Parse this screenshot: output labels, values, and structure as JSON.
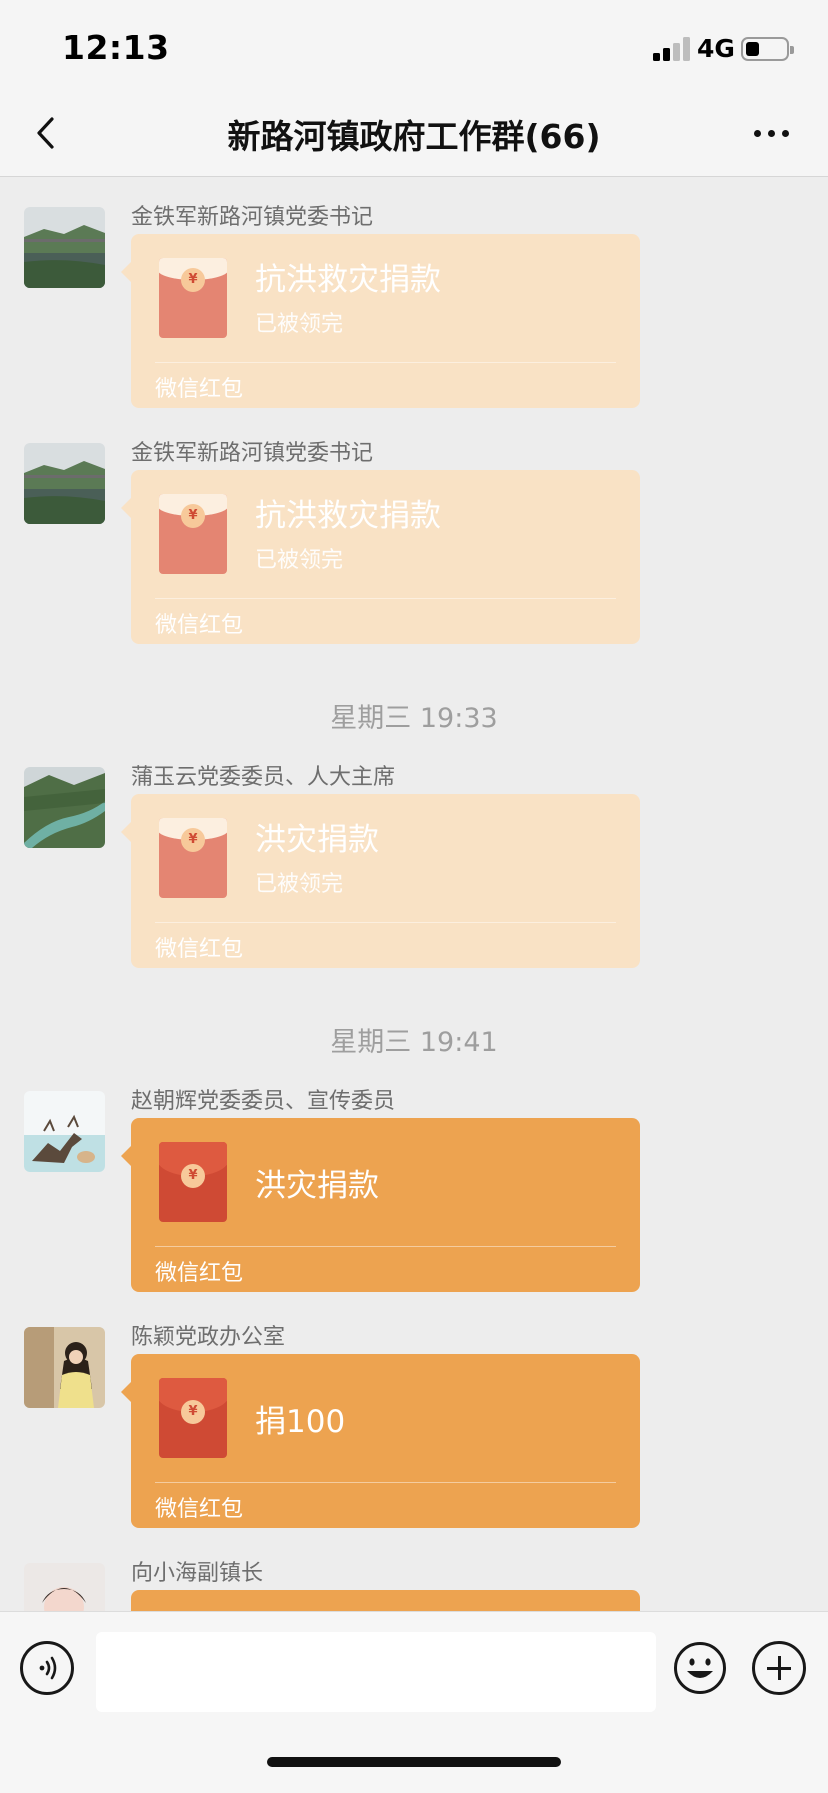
{
  "status_bar": {
    "time": "12:13",
    "network": "4G",
    "battery_level": 0.35
  },
  "header": {
    "title": "新路河镇政府工作群(66)"
  },
  "messages": [
    {
      "sender": "金铁军新路河镇党委书记",
      "title": "抗洪救灾捐款",
      "status": "已被领完",
      "footer": "微信红包",
      "opened": true
    },
    {
      "sender": "金铁军新路河镇党委书记",
      "title": "抗洪救灾捐款",
      "status": "已被领完",
      "footer": "微信红包",
      "opened": true
    },
    {
      "sender": "蒲玉云党委委员、人大主席",
      "title": "洪灾捐款",
      "status": "已被领完",
      "footer": "微信红包",
      "opened": true
    },
    {
      "sender": "赵朝辉党委委员、宣传委员",
      "title": "洪灾捐款",
      "footer": "微信红包",
      "opened": false
    },
    {
      "sender": "陈颖党政办公室",
      "title": "捐100",
      "footer": "微信红包",
      "opened": false
    },
    {
      "sender": "向小海副镇长",
      "opened": false
    }
  ],
  "timestamps": [
    "星期三 19:33",
    "星期三 19:41"
  ],
  "icons": {
    "back": "chevron-left-icon",
    "more": "more-dots-icon",
    "voice": "voice-icon",
    "emoji": "emoji-icon",
    "plus": "plus-icon",
    "red_packet": "red-packet-icon"
  },
  "colors": {
    "packet_opened": "#f9e2c5",
    "packet_unopened": "#eda350",
    "envelope_red": "#cf4a34"
  }
}
